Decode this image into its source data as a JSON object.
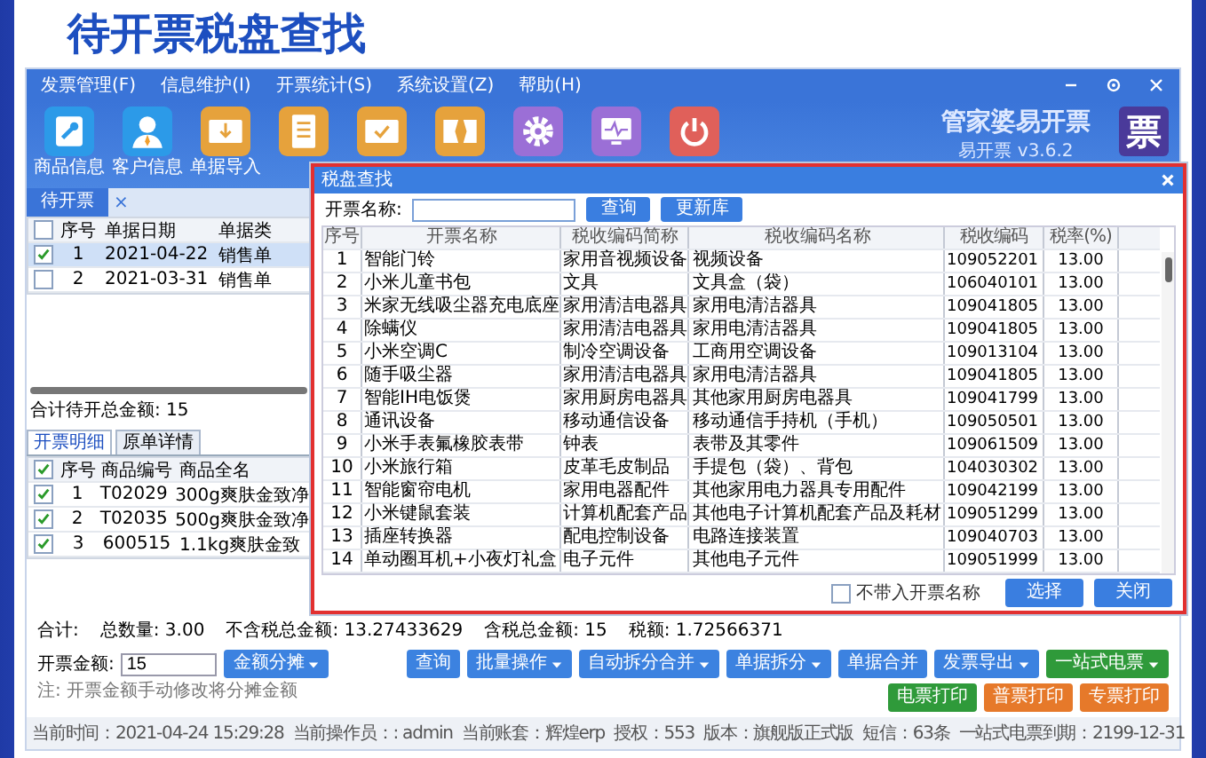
{
  "page_title": "待开票税盘查找",
  "menu": [
    "发票管理(F)",
    "信息维护(I)",
    "开票统计(S)",
    "系统设置(Z)",
    "帮助(H)"
  ],
  "toolbar": [
    {
      "kind": "wrench",
      "label": "商品信息"
    },
    {
      "kind": "person",
      "label": "客户信息"
    },
    {
      "kind": "import",
      "label": "单据导入"
    },
    {
      "kind": "list"
    },
    {
      "kind": "check"
    },
    {
      "kind": "split"
    },
    {
      "kind": "gear"
    },
    {
      "kind": "monitor"
    },
    {
      "kind": "power"
    }
  ],
  "brand": {
    "name": "管家婆易开票",
    "version": "易开票 v3.6.2",
    "logo": "票"
  },
  "doc_tab": {
    "label": "待开票",
    "close": "×"
  },
  "orders": {
    "all_checked": false,
    "columns": [
      "序号",
      "单据日期",
      "单据类"
    ],
    "rows": [
      {
        "no": "1",
        "date": "2021-04-22",
        "type": "销售单",
        "checked": true,
        "selected": true
      },
      {
        "no": "2",
        "date": "2021-03-31",
        "type": "销售单",
        "checked": false,
        "selected": false
      }
    ]
  },
  "orders_total": "合计待开总金额: 15",
  "detail_tabs": [
    {
      "label": "开票明细",
      "selected": true
    },
    {
      "label": "原单详情",
      "selected": false
    }
  ],
  "details": {
    "all_checked": true,
    "columns": [
      "序号",
      "商品编号",
      "商品全名"
    ],
    "rows": [
      {
        "no": "1",
        "code": "T02029",
        "name": "300g爽肤金致净",
        "checked": true
      },
      {
        "no": "2",
        "code": "T02035",
        "name": "500g爽肤金致净",
        "checked": true
      },
      {
        "no": "3",
        "code": "600515",
        "name": "1.1kg爽肤金致",
        "checked": true
      }
    ]
  },
  "summary": [
    "合计:",
    "总数量: 3.00",
    "不含税总金额: 13.27433629",
    "含税总金额: 15",
    "税额: 1.72566371"
  ],
  "amount": {
    "label": "开票金额:",
    "value": "15",
    "split_button": "金额分摊",
    "note": "注: 开票金额手动修改将分摊金额"
  },
  "actions": [
    {
      "label": "查询",
      "kind": "blue",
      "dropdown": false
    },
    {
      "label": "批量操作",
      "kind": "blue",
      "dropdown": true
    },
    {
      "label": "自动拆分合并",
      "kind": "blue",
      "dropdown": true
    },
    {
      "label": "单据拆分",
      "kind": "blue",
      "dropdown": true
    },
    {
      "label": "单据合并",
      "kind": "blue",
      "dropdown": false
    },
    {
      "label": "发票导出",
      "kind": "blue",
      "dropdown": true
    },
    {
      "label": "一站式电票",
      "kind": "green",
      "dropdown": true
    },
    {
      "label": "电票打印",
      "kind": "green",
      "dropdown": false
    },
    {
      "label": "普票打印",
      "kind": "orange",
      "dropdown": false
    },
    {
      "label": "专票打印",
      "kind": "orange",
      "dropdown": false
    }
  ],
  "status": [
    "当前时间：2021-04-24 15:29:28",
    "当前操作员：: admin",
    "当前账套：辉煌erp",
    "授权：553",
    "版本：旗舰版正式版",
    "短信：63条",
    "一站式电票到期：2199-12-31"
  ],
  "dialog": {
    "title": "税盘查找",
    "search_label": "开票名称:",
    "buttons": [
      "查询",
      "更新库"
    ],
    "columns": [
      "序号",
      "开票名称",
      "税收编码简称",
      "税收编码名称",
      "税收编码",
      "税率(%)"
    ],
    "rows": [
      [
        "1",
        "智能门铃",
        "家用音视频设备",
        "视频设备",
        "109052201",
        "13.00"
      ],
      [
        "2",
        "小米儿童书包",
        "文具",
        "文具盒（袋）",
        "106040101",
        "13.00"
      ],
      [
        "3",
        "米家无线吸尘器充电底座",
        "家用清洁电器具",
        "家用电清洁器具",
        "109041805",
        "13.00"
      ],
      [
        "4",
        "除螨仪",
        "家用清洁电器具",
        "家用电清洁器具",
        "109041805",
        "13.00"
      ],
      [
        "5",
        "小米空调C",
        "制冷空调设备",
        "工商用空调设备",
        "109013104",
        "13.00"
      ],
      [
        "6",
        "随手吸尘器",
        "家用清洁电器具",
        "家用电清洁器具",
        "109041805",
        "13.00"
      ],
      [
        "7",
        "智能IH电饭煲",
        "家用厨房电器具",
        "其他家用厨房电器具",
        "109041799",
        "13.00"
      ],
      [
        "8",
        "通讯设备",
        "移动通信设备",
        "移动通信手持机（手机）",
        "109050501",
        "13.00"
      ],
      [
        "9",
        "小米手表氟橡胶表带",
        "钟表",
        "表带及其零件",
        "109061509",
        "13.00"
      ],
      [
        "10",
        "小米旅行箱",
        "皮革毛皮制品",
        "手提包（袋）、背包",
        "104030302",
        "13.00"
      ],
      [
        "11",
        "智能窗帘电机",
        "家用电器配件",
        "其他家用电力器具专用配件",
        "109042199",
        "13.00"
      ],
      [
        "12",
        "小米键鼠套装",
        "计算机配套产品",
        "其他电子计算机配套产品及耗材",
        "109051299",
        "13.00"
      ],
      [
        "13",
        "插座转换器",
        "配电控制设备",
        "电路连接装置",
        "109040703",
        "13.00"
      ],
      [
        "14",
        "单动圈耳机+小夜灯礼盒",
        "电子元件",
        "其他电子元件",
        "109051999",
        "13.00"
      ]
    ],
    "option": {
      "label": "不带入开票名称",
      "checked": false
    },
    "footer_buttons": [
      "选择",
      "关闭"
    ]
  }
}
